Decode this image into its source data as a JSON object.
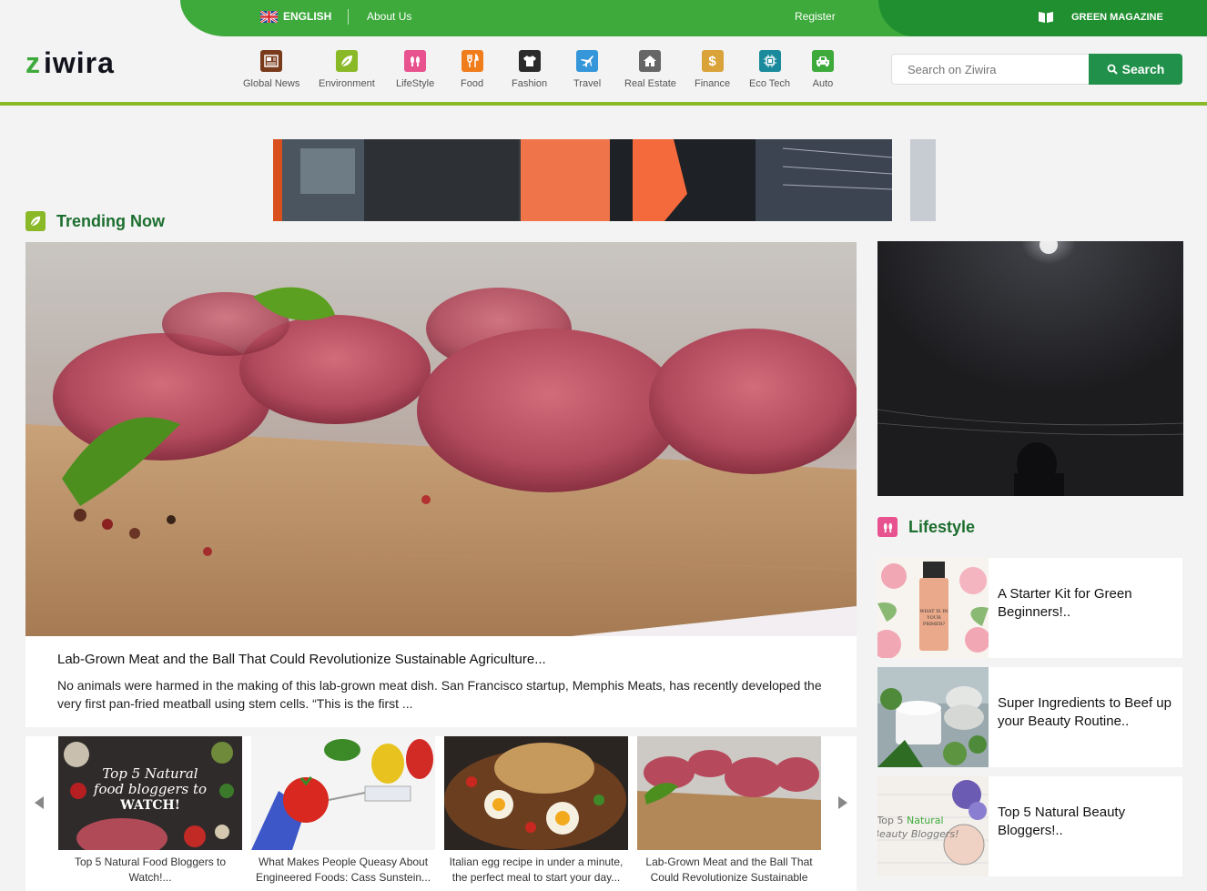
{
  "topbar": {
    "language": "ENGLISH",
    "about": "About Us",
    "register": "Register",
    "green_magazine": "GREEN MAGAZINE"
  },
  "header": {
    "logo": "ziwira",
    "nav": [
      {
        "label": "Global News",
        "icon": "newspaper-icon",
        "color": "#7a3b1c"
      },
      {
        "label": "Environment",
        "icon": "leaf-icon",
        "color": "#8ab927"
      },
      {
        "label": "LifeStyle",
        "icon": "footprints-icon",
        "color": "#e8528f"
      },
      {
        "label": "Food",
        "icon": "fork-knife-icon",
        "color": "#f07d1c"
      },
      {
        "label": "Fashion",
        "icon": "tshirt-icon",
        "color": "#2b2b2b"
      },
      {
        "label": "Travel",
        "icon": "airplane-icon",
        "color": "#3596d9"
      },
      {
        "label": "Real Estate",
        "icon": "house-icon",
        "color": "#666666"
      },
      {
        "label": "Finance",
        "icon": "dollar-icon",
        "color": "#d9a33a"
      },
      {
        "label": "Eco Tech",
        "icon": "chip-icon",
        "color": "#1a8a9c"
      },
      {
        "label": "Auto",
        "icon": "car-icon",
        "color": "#3daa3b"
      }
    ],
    "search_placeholder": "Search on Ziwira",
    "search_button": "Search"
  },
  "trending": {
    "heading": "Trending Now",
    "hero_title": "Lab-Grown Meat and the Ball That Could Revolutionize Sustainable Agriculture...",
    "hero_desc": "No animals were harmed in the making of this lab-grown meat dish. San Francisco startup, Memphis Meats, has recently developed the very first pan-fried meatball using stem cells. “This is the first ...",
    "carousel": [
      {
        "caption": "Top 5 Natural Food Bloggers to Watch!...",
        "thumb_text": "Top 5 Natural food bloggers to WATCH!"
      },
      {
        "caption": "What Makes People Queasy About Engineered Foods: Cass Sunstein..."
      },
      {
        "caption": "Italian egg recipe in under a minute, the perfect meal to start your day..."
      },
      {
        "caption": "Lab-Grown Meat and the Ball That Could Revolutionize Sustainable"
      }
    ]
  },
  "lifestyle": {
    "heading": "Lifestyle",
    "items": [
      {
        "title": "A Starter Kit for Green Beginners!.."
      },
      {
        "title": "Super Ingredients to Beef up your Beauty Routine.."
      },
      {
        "title": "Top 5 Natural Beauty Bloggers!..",
        "thumb_text": "Top 5 Natural Beauty Bloggers!"
      }
    ]
  },
  "colors": {
    "brand_green": "#3daa3b",
    "dark_green": "#1f8f2f",
    "accent_line": "#8ab927",
    "lifestyle_pink": "#e8528f"
  }
}
